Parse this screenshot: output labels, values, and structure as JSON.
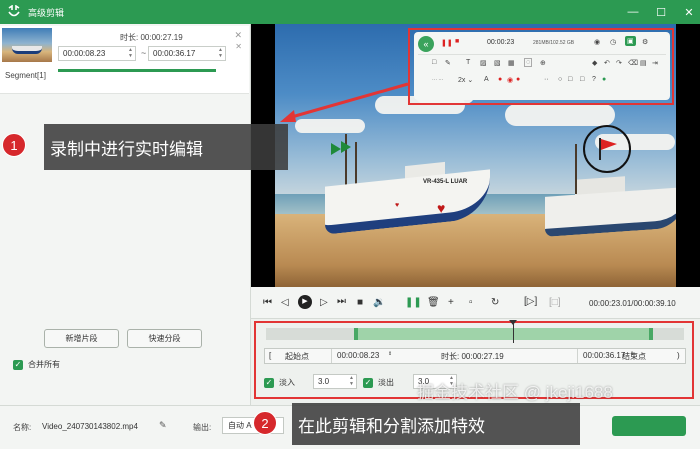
{
  "window": {
    "title": "高级剪辑",
    "controls": [
      "minimize-icon",
      "maximize-icon",
      "close-icon"
    ]
  },
  "segment": {
    "duration_label": "时长: 00:00:27.19",
    "start_time": "00:00:08.23",
    "end_time": "00:00:36.17",
    "separator": "~",
    "label": "Segment[1]"
  },
  "left_buttons": {
    "new_segment": "新增片段",
    "quick_split": "快速分段"
  },
  "merge_all": {
    "label": "合并所有",
    "checked": true
  },
  "recording_toolbar": {
    "time": "00:00:23",
    "size": "281MB/102.52 GB"
  },
  "player": {
    "time_display": "00:00:23.01/00:00:39.10"
  },
  "trim": {
    "start_label": "起始点",
    "start_time": "00:00:08.23",
    "duration_label": "时长: 00:00:27.19",
    "end_time": "00:00:36.17",
    "end_label": "结束点",
    "selection_start_fraction": 0.21,
    "selection_end_fraction": 0.925,
    "playhead_fraction": 0.59
  },
  "fade": {
    "fade_in_label": "淡入",
    "fade_in_value": "3.0",
    "fade_in_checked": true,
    "fade_out_label": "淡出",
    "fade_out_value": "3.0",
    "fade_out_checked": true
  },
  "bottom": {
    "name_label": "名称:",
    "file_name": "Video_240730143802.mp4",
    "output_label": "输出:",
    "output_value": "自动 A"
  },
  "callouts": [
    {
      "number": "1",
      "text": "录制中进行实时编辑"
    },
    {
      "number": "2",
      "text": "在此剪辑和分割添加特效"
    }
  ],
  "watermark": "掘金技术社区 @ jkeji1688",
  "boat_label": "VR-435-L LUAR",
  "colors": {
    "accent": "#2c9a52",
    "highlight_red": "#e23535",
    "callout_red": "#d6282c"
  }
}
